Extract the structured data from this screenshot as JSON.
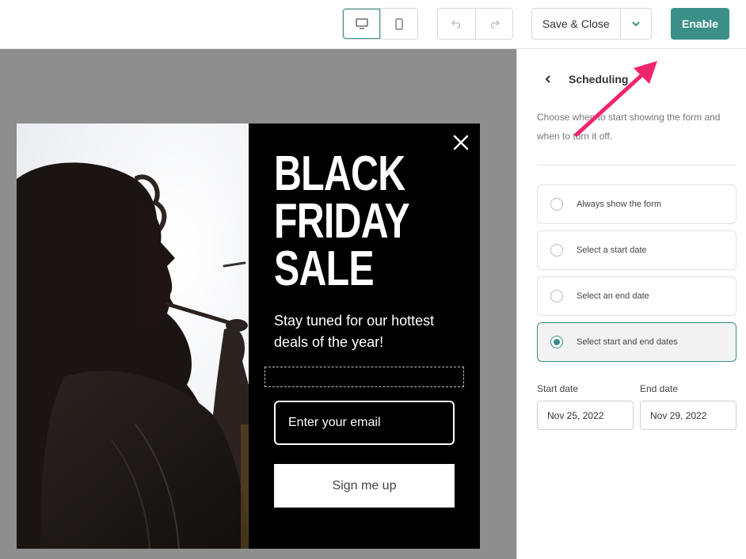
{
  "toolbar": {
    "device_desktop_icon": "desktop-icon",
    "device_mobile_icon": "mobile-icon",
    "undo_icon": "undo-icon",
    "redo_icon": "redo-icon",
    "save_label": "Save & Close",
    "enable_label": "Enable",
    "accent_color": "#3a8f88"
  },
  "popup": {
    "headline": [
      "BLACK",
      "FRIDAY",
      "SALE"
    ],
    "subtext": "Stay tuned for our hottest deals of the year!",
    "email_placeholder": "Enter your email",
    "button_label": "Sign me up"
  },
  "panel": {
    "title": "Scheduling",
    "description": "Choose when to start showing the form and when to turn it off.",
    "options": [
      {
        "label": "Always show the form",
        "selected": false
      },
      {
        "label": "Select a start date",
        "selected": false
      },
      {
        "label": "Select an end date",
        "selected": false
      },
      {
        "label": "Select start and end dates",
        "selected": true
      }
    ],
    "start_label": "Start date",
    "start_value": "Nov 25, 2022",
    "end_label": "End date",
    "end_value": "Nov 29, 2022"
  }
}
